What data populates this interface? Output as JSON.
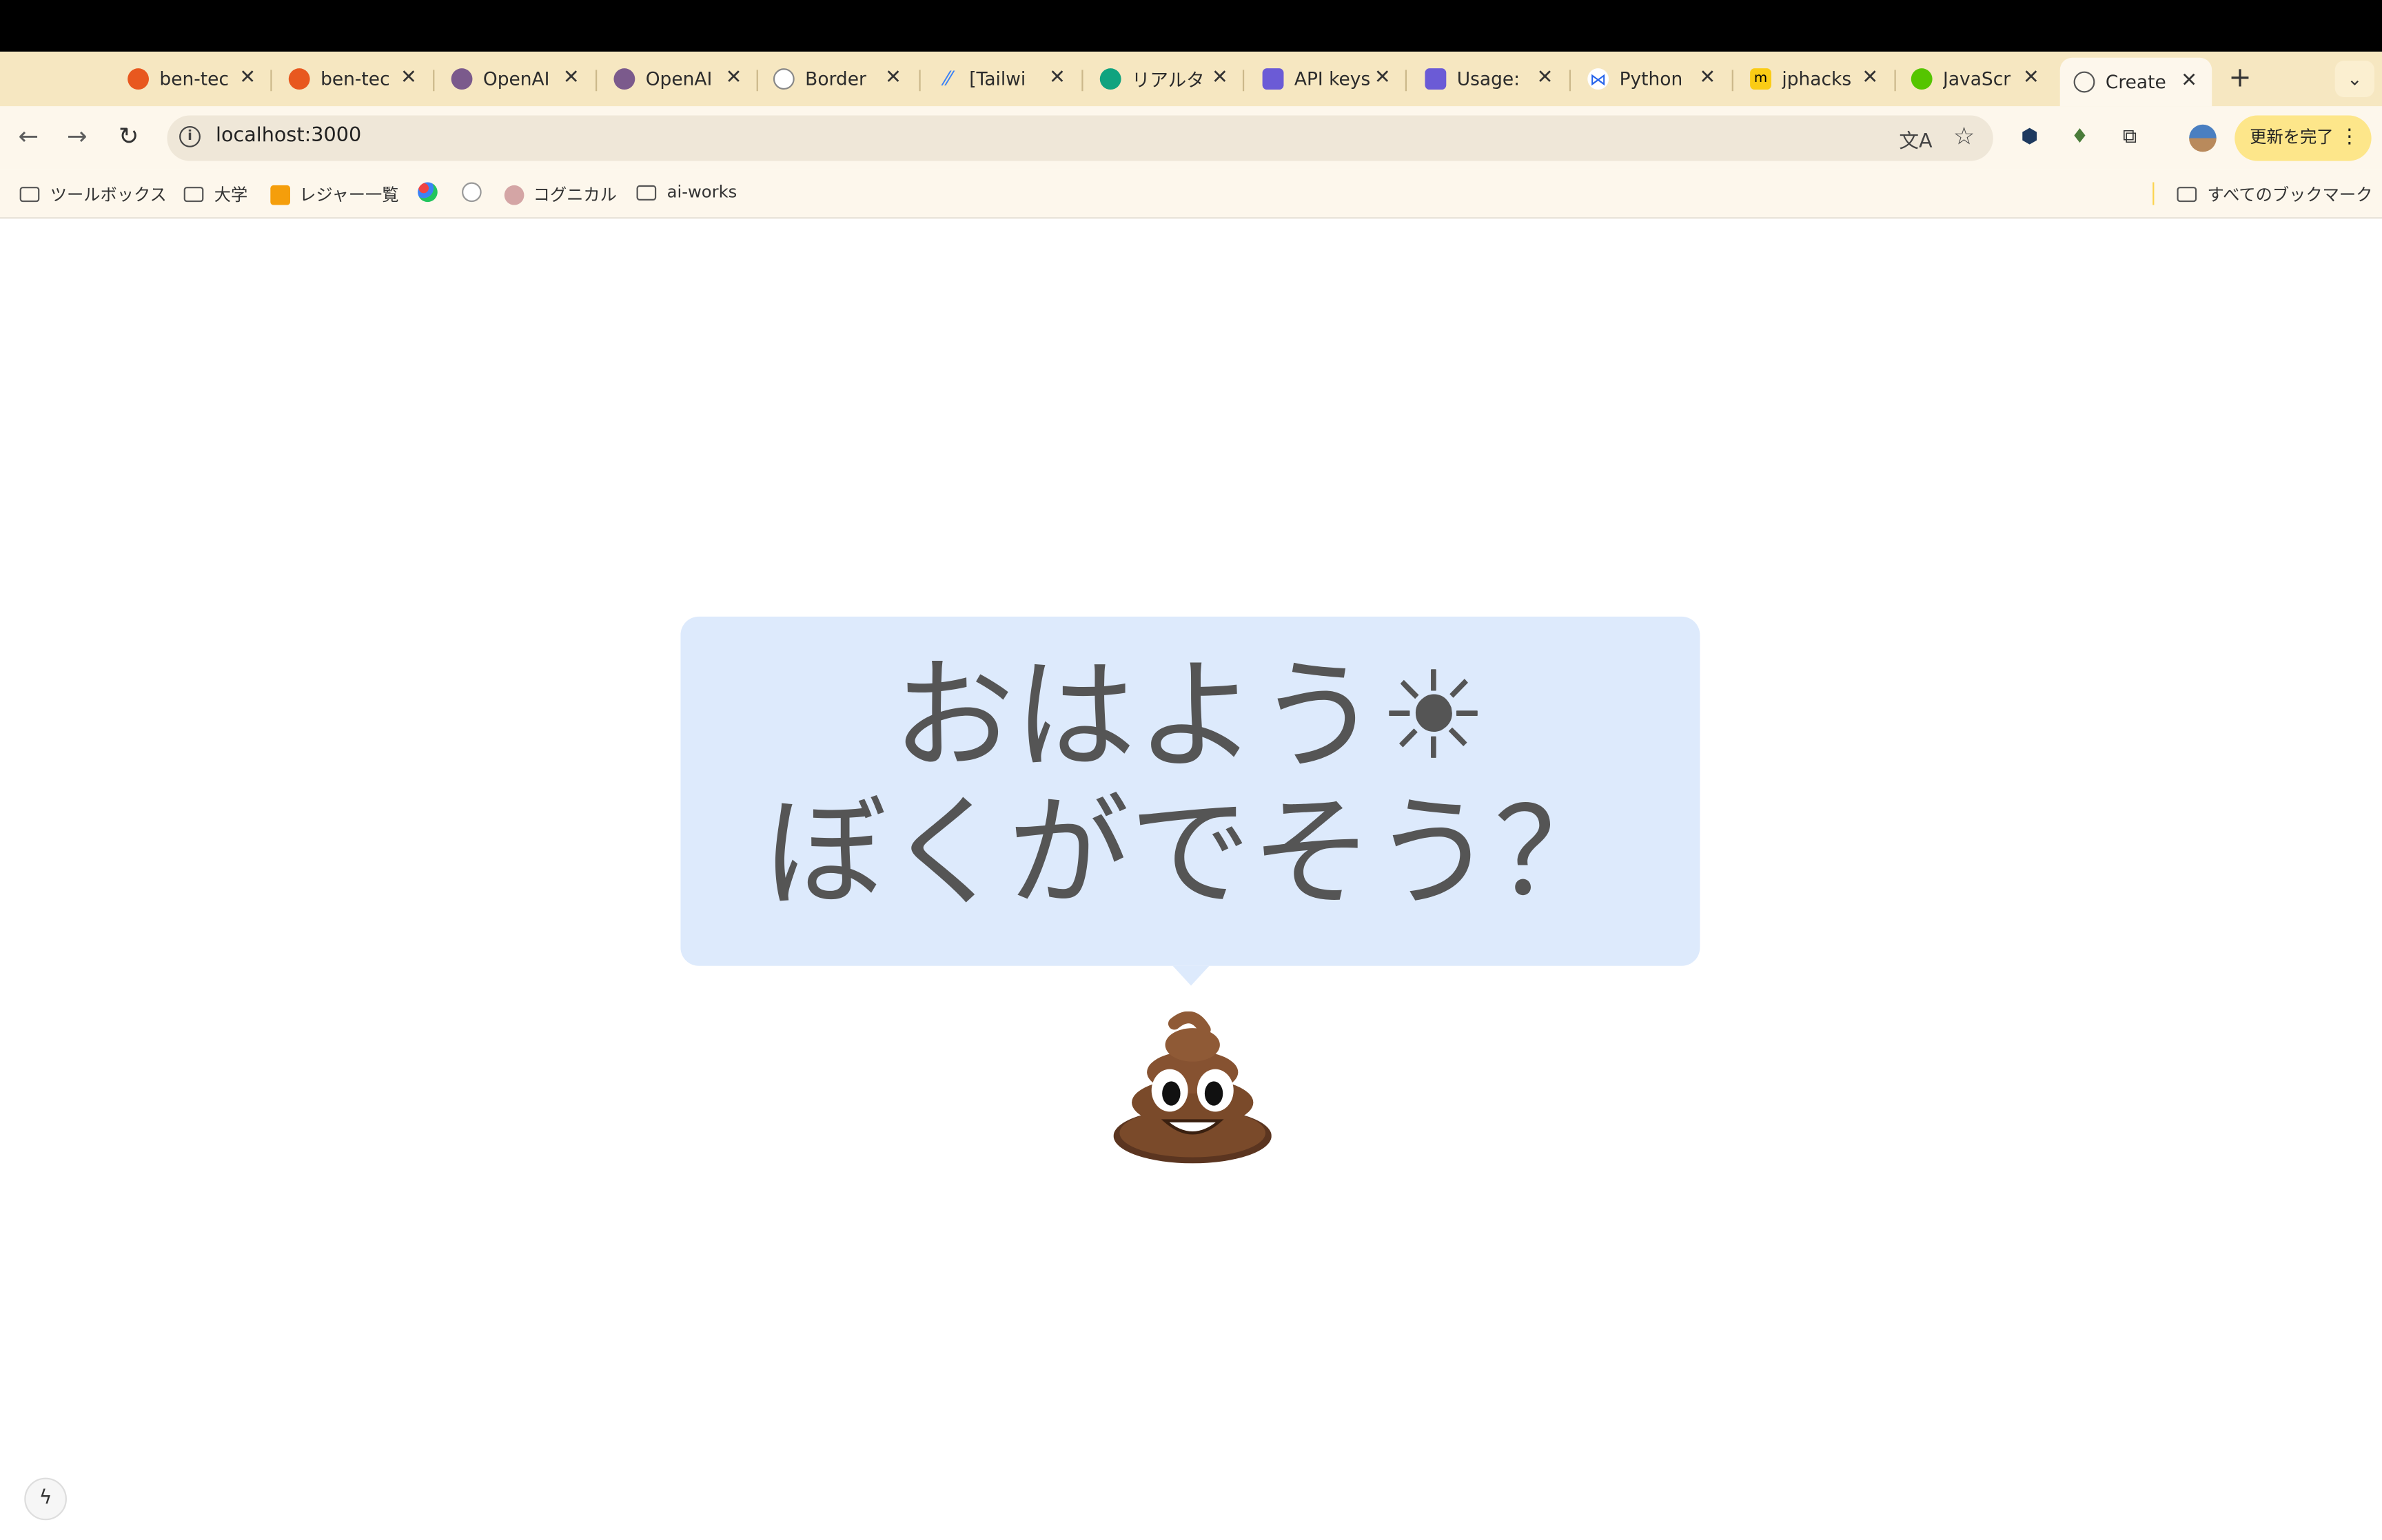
{
  "browser": {
    "tabs": [
      {
        "title": "ben-tec",
        "favicon": "flame-icon"
      },
      {
        "title": "ben-tec",
        "favicon": "flame-icon"
      },
      {
        "title": "OpenAI",
        "favicon": "openai-icon"
      },
      {
        "title": "OpenAI",
        "favicon": "openai-icon"
      },
      {
        "title": "Border",
        "favicon": "border-icon"
      },
      {
        "title": "[Tailwi",
        "favicon": "tailwind-icon"
      },
      {
        "title": "リアルタ",
        "favicon": "chatgpt-icon"
      },
      {
        "title": "API keys",
        "favicon": "openai-purple-icon"
      },
      {
        "title": "Usage:",
        "favicon": "openai-purple-icon"
      },
      {
        "title": "Python",
        "favicon": "python-icon"
      },
      {
        "title": "jphacks",
        "favicon": "miro-icon"
      },
      {
        "title": "JavaScr",
        "favicon": "qiita-icon"
      },
      {
        "title": "Create",
        "favicon": "globe-icon",
        "active": true
      }
    ],
    "url": "localhost:3000",
    "update_button": "更新を完了",
    "bookmarks": [
      {
        "label": "ツールボックス",
        "type": "folder"
      },
      {
        "label": "大学",
        "type": "folder"
      },
      {
        "label": "レジャー一覧",
        "type": "site"
      },
      {
        "label": "",
        "type": "site"
      },
      {
        "label": "",
        "type": "site"
      },
      {
        "label": "コグニカル",
        "type": "site"
      },
      {
        "label": "ai-works",
        "type": "folder"
      }
    ],
    "all_bookmarks": "すべてのブックマーク"
  },
  "page": {
    "line1": "おはよう☀",
    "line2": "ぼくがでそう？",
    "emoji": "poop-emoji"
  }
}
